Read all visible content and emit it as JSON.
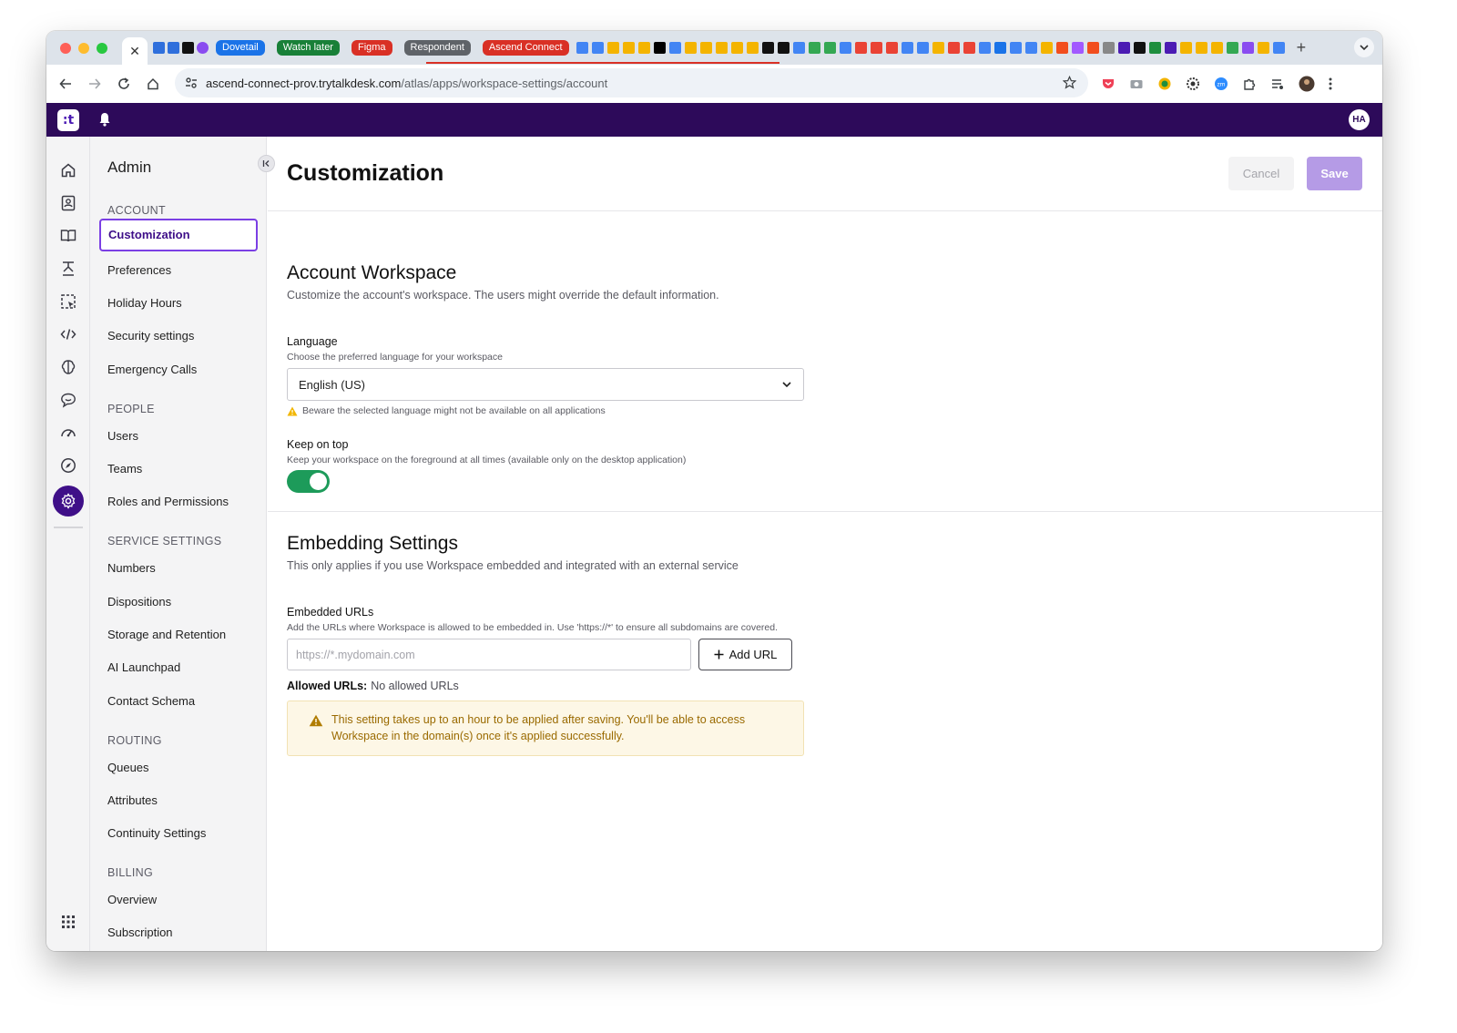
{
  "browser": {
    "active_tab_close": "✕",
    "tab_pills": [
      {
        "label": "Dovetail",
        "color": "#1a73e8"
      },
      {
        "label": "Watch later",
        "color": "#188038"
      },
      {
        "label": "Figma",
        "color": "#d93025"
      },
      {
        "label": "Respondent",
        "color": "#5f6368"
      },
      {
        "label": "Ascend Connect",
        "color": "#d93025"
      }
    ],
    "new_tab": "+",
    "url_host": "ascend-connect-prov.trytalkdesk.com",
    "url_path": "/atlas/apps/workspace-settings/account"
  },
  "app": {
    "logo_text": ":t",
    "user_initials": "HA",
    "brand_color": "#2d0a5a"
  },
  "sidebar": {
    "title": "Admin",
    "sections": {
      "account": "ACCOUNT",
      "people": "PEOPLE",
      "service": "SERVICE SETTINGS",
      "routing": "ROUTING",
      "billing": "BILLING"
    },
    "items": {
      "customization": "Customization",
      "preferences": "Preferences",
      "holiday": "Holiday Hours",
      "security": "Security settings",
      "emergency": "Emergency Calls",
      "users": "Users",
      "teams": "Teams",
      "roles": "Roles and Permissions",
      "numbers": "Numbers",
      "dispositions": "Dispositions",
      "storage": "Storage and Retention",
      "ai": "AI Launchpad",
      "contact": "Contact Schema",
      "queues": "Queues",
      "attributes": "Attributes",
      "continuity": "Continuity Settings",
      "overview": "Overview",
      "subscription": "Subscription"
    }
  },
  "main": {
    "title": "Customization",
    "cancel_label": "Cancel",
    "save_label": "Save",
    "account_workspace": {
      "title": "Account Workspace",
      "description": "Customize the account's workspace. The users might override the default information.",
      "language_label": "Language",
      "language_help": "Choose the preferred language for your workspace",
      "language_value": "English (US)",
      "language_warning": "Beware the selected language might not be available on all applications",
      "keep_on_top_label": "Keep on top",
      "keep_on_top_help": "Keep your workspace on the foreground at all times (available only on the desktop application)",
      "keep_on_top_enabled": true
    },
    "embedding": {
      "title": "Embedding Settings",
      "description": "This only applies if you use Workspace embedded and integrated with an external service",
      "urls_label": "Embedded URLs",
      "urls_help": "Add the URLs where Workspace is allowed to be embedded in. Use 'https://*' to ensure all subdomains are covered.",
      "url_placeholder": "https://*.mydomain.com",
      "add_url_label": "Add URL",
      "allowed_label": "Allowed URLs:",
      "allowed_value": "No allowed URLs",
      "alert_text": "This setting takes up to an hour to be applied after saving. You'll be able to access Workspace in the domain(s) once it's applied successfully."
    }
  }
}
